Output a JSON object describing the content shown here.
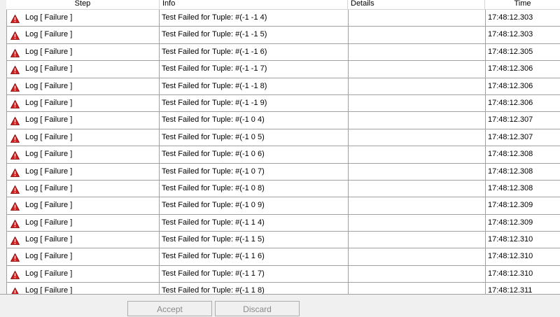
{
  "table": {
    "columns": {
      "step": "Step",
      "info": "Info",
      "details": "Details",
      "time": "Time"
    },
    "rows": [
      {
        "step": "Log [ Failure ]",
        "info": "Test Failed for Tuple: #(-1 -1 4)",
        "details": "",
        "time": "17:48:12.303"
      },
      {
        "step": "Log [ Failure ]",
        "info": "Test Failed for Tuple: #(-1 -1 5)",
        "details": "",
        "time": "17:48:12.303"
      },
      {
        "step": "Log [ Failure ]",
        "info": "Test Failed for Tuple: #(-1 -1 6)",
        "details": "",
        "time": "17:48:12.305"
      },
      {
        "step": "Log [ Failure ]",
        "info": "Test Failed for Tuple: #(-1 -1 7)",
        "details": "",
        "time": "17:48:12.306"
      },
      {
        "step": "Log [ Failure ]",
        "info": "Test Failed for Tuple: #(-1 -1 8)",
        "details": "",
        "time": "17:48:12.306"
      },
      {
        "step": "Log [ Failure ]",
        "info": "Test Failed for Tuple: #(-1 -1 9)",
        "details": "",
        "time": "17:48:12.306"
      },
      {
        "step": "Log [ Failure ]",
        "info": "Test Failed for Tuple: #(-1 0 4)",
        "details": "",
        "time": "17:48:12.307"
      },
      {
        "step": "Log [ Failure ]",
        "info": "Test Failed for Tuple: #(-1 0 5)",
        "details": "",
        "time": "17:48:12.307"
      },
      {
        "step": "Log [ Failure ]",
        "info": "Test Failed for Tuple: #(-1 0 6)",
        "details": "",
        "time": "17:48:12.308"
      },
      {
        "step": "Log [ Failure ]",
        "info": "Test Failed for Tuple: #(-1 0 7)",
        "details": "",
        "time": "17:48:12.308"
      },
      {
        "step": "Log [ Failure ]",
        "info": "Test Failed for Tuple: #(-1 0 8)",
        "details": "",
        "time": "17:48:12.308"
      },
      {
        "step": "Log [ Failure ]",
        "info": "Test Failed for Tuple: #(-1 0 9)",
        "details": "",
        "time": "17:48:12.309"
      },
      {
        "step": "Log [ Failure ]",
        "info": "Test Failed for Tuple: #(-1 1 4)",
        "details": "",
        "time": "17:48:12.309"
      },
      {
        "step": "Log [ Failure ]",
        "info": "Test Failed for Tuple: #(-1 1 5)",
        "details": "",
        "time": "17:48:12.310"
      },
      {
        "step": "Log [ Failure ]",
        "info": "Test Failed for Tuple: #(-1 1 6)",
        "details": "",
        "time": "17:48:12.310"
      },
      {
        "step": "Log [ Failure ]",
        "info": "Test Failed for Tuple: #(-1 1 7)",
        "details": "",
        "time": "17:48:12.310"
      },
      {
        "step": "Log [ Failure ]",
        "info": "Test Failed for Tuple: #(-1 1 8)",
        "details": "",
        "time": "17:48:12.311"
      }
    ],
    "row_icon": "warning-icon"
  },
  "buttons": {
    "accept": "Accept",
    "discard": "Discard"
  },
  "colors": {
    "warning_red": "#d42020",
    "grid_line": "#a0a0a0",
    "disabled_text": "#8a8a8a"
  }
}
